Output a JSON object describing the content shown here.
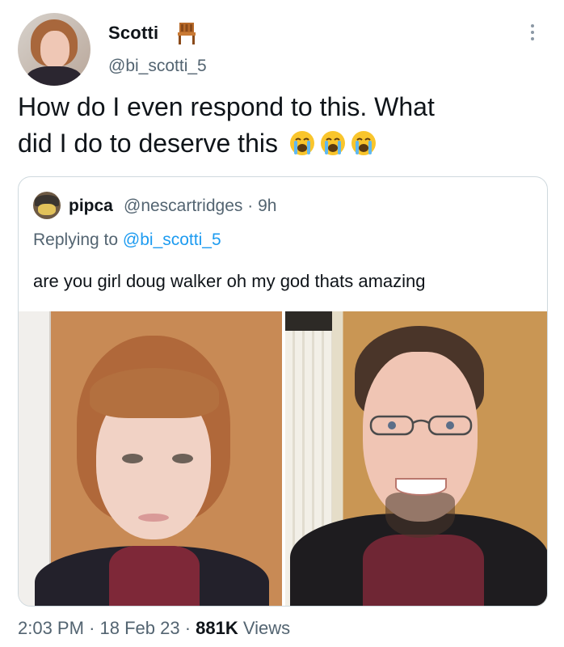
{
  "tweet": {
    "author_name": "Scotti",
    "author_handle": "@bi_scotti_5",
    "text_line1": "How do I even respond to this. What",
    "text_line2": "did I do to deserve this",
    "emoji": [
      "crying-face-emoji",
      "crying-face-emoji",
      "crying-face-emoji"
    ],
    "name_emoji": "chair-emoji"
  },
  "quote": {
    "author_name": "pipca",
    "author_handle": "@nescartridges",
    "separator": "·",
    "time_ago": "9h",
    "replying_prefix": "Replying to",
    "replying_to": "@bi_scotti_5",
    "text": "are you girl doug walker oh my god thats amazing"
  },
  "footer": {
    "time": "2:03 PM",
    "separator": "·",
    "date": "18 Feb 23",
    "views_count": "881K",
    "views_label": "Views"
  },
  "colors": {
    "text": "#0f1419",
    "secondary": "#536471",
    "link": "#1d9bf0",
    "border": "#cfd9de"
  }
}
